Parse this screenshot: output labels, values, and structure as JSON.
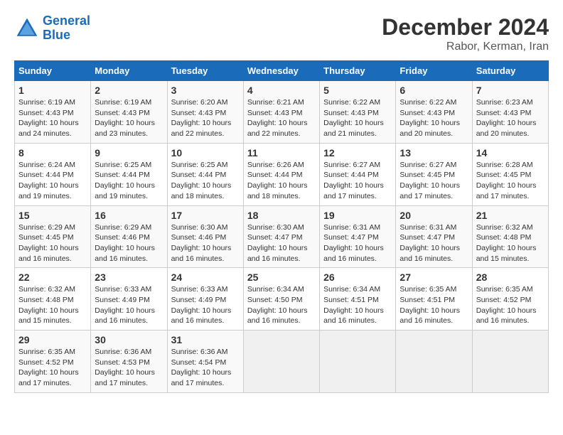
{
  "header": {
    "logo_line1": "General",
    "logo_line2": "Blue",
    "title": "December 2024",
    "subtitle": "Rabor, Kerman, Iran"
  },
  "calendar": {
    "days_of_week": [
      "Sunday",
      "Monday",
      "Tuesday",
      "Wednesday",
      "Thursday",
      "Friday",
      "Saturday"
    ],
    "weeks": [
      [
        {
          "day": "",
          "info": ""
        },
        {
          "day": "2",
          "info": "Sunrise: 6:19 AM\nSunset: 4:43 PM\nDaylight: 10 hours\nand 23 minutes."
        },
        {
          "day": "3",
          "info": "Sunrise: 6:20 AM\nSunset: 4:43 PM\nDaylight: 10 hours\nand 22 minutes."
        },
        {
          "day": "4",
          "info": "Sunrise: 6:21 AM\nSunset: 4:43 PM\nDaylight: 10 hours\nand 22 minutes."
        },
        {
          "day": "5",
          "info": "Sunrise: 6:22 AM\nSunset: 4:43 PM\nDaylight: 10 hours\nand 21 minutes."
        },
        {
          "day": "6",
          "info": "Sunrise: 6:22 AM\nSunset: 4:43 PM\nDaylight: 10 hours\nand 20 minutes."
        },
        {
          "day": "7",
          "info": "Sunrise: 6:23 AM\nSunset: 4:43 PM\nDaylight: 10 hours\nand 20 minutes."
        }
      ],
      [
        {
          "day": "1",
          "info": "Sunrise: 6:19 AM\nSunset: 4:43 PM\nDaylight: 10 hours\nand 24 minutes."
        },
        {
          "day": "9",
          "info": "Sunrise: 6:25 AM\nSunset: 4:44 PM\nDaylight: 10 hours\nand 19 minutes."
        },
        {
          "day": "10",
          "info": "Sunrise: 6:25 AM\nSunset: 4:44 PM\nDaylight: 10 hours\nand 18 minutes."
        },
        {
          "day": "11",
          "info": "Sunrise: 6:26 AM\nSunset: 4:44 PM\nDaylight: 10 hours\nand 18 minutes."
        },
        {
          "day": "12",
          "info": "Sunrise: 6:27 AM\nSunset: 4:44 PM\nDaylight: 10 hours\nand 17 minutes."
        },
        {
          "day": "13",
          "info": "Sunrise: 6:27 AM\nSunset: 4:45 PM\nDaylight: 10 hours\nand 17 minutes."
        },
        {
          "day": "14",
          "info": "Sunrise: 6:28 AM\nSunset: 4:45 PM\nDaylight: 10 hours\nand 17 minutes."
        }
      ],
      [
        {
          "day": "8",
          "info": "Sunrise: 6:24 AM\nSunset: 4:44 PM\nDaylight: 10 hours\nand 19 minutes."
        },
        {
          "day": "16",
          "info": "Sunrise: 6:29 AM\nSunset: 4:46 PM\nDaylight: 10 hours\nand 16 minutes."
        },
        {
          "day": "17",
          "info": "Sunrise: 6:30 AM\nSunset: 4:46 PM\nDaylight: 10 hours\nand 16 minutes."
        },
        {
          "day": "18",
          "info": "Sunrise: 6:30 AM\nSunset: 4:47 PM\nDaylight: 10 hours\nand 16 minutes."
        },
        {
          "day": "19",
          "info": "Sunrise: 6:31 AM\nSunset: 4:47 PM\nDaylight: 10 hours\nand 16 minutes."
        },
        {
          "day": "20",
          "info": "Sunrise: 6:31 AM\nSunset: 4:47 PM\nDaylight: 10 hours\nand 16 minutes."
        },
        {
          "day": "21",
          "info": "Sunrise: 6:32 AM\nSunset: 4:48 PM\nDaylight: 10 hours\nand 15 minutes."
        }
      ],
      [
        {
          "day": "15",
          "info": "Sunrise: 6:29 AM\nSunset: 4:45 PM\nDaylight: 10 hours\nand 16 minutes."
        },
        {
          "day": "23",
          "info": "Sunrise: 6:33 AM\nSunset: 4:49 PM\nDaylight: 10 hours\nand 16 minutes."
        },
        {
          "day": "24",
          "info": "Sunrise: 6:33 AM\nSunset: 4:49 PM\nDaylight: 10 hours\nand 16 minutes."
        },
        {
          "day": "25",
          "info": "Sunrise: 6:34 AM\nSunset: 4:50 PM\nDaylight: 10 hours\nand 16 minutes."
        },
        {
          "day": "26",
          "info": "Sunrise: 6:34 AM\nSunset: 4:51 PM\nDaylight: 10 hours\nand 16 minutes."
        },
        {
          "day": "27",
          "info": "Sunrise: 6:35 AM\nSunset: 4:51 PM\nDaylight: 10 hours\nand 16 minutes."
        },
        {
          "day": "28",
          "info": "Sunrise: 6:35 AM\nSunset: 4:52 PM\nDaylight: 10 hours\nand 16 minutes."
        }
      ],
      [
        {
          "day": "22",
          "info": "Sunrise: 6:32 AM\nSunset: 4:48 PM\nDaylight: 10 hours\nand 15 minutes."
        },
        {
          "day": "30",
          "info": "Sunrise: 6:36 AM\nSunset: 4:53 PM\nDaylight: 10 hours\nand 17 minutes."
        },
        {
          "day": "31",
          "info": "Sunrise: 6:36 AM\nSunset: 4:54 PM\nDaylight: 10 hours\nand 17 minutes."
        },
        {
          "day": "",
          "info": ""
        },
        {
          "day": "",
          "info": ""
        },
        {
          "day": "",
          "info": ""
        },
        {
          "day": "",
          "info": ""
        }
      ],
      [
        {
          "day": "29",
          "info": "Sunrise: 6:35 AM\nSunset: 4:52 PM\nDaylight: 10 hours\nand 17 minutes."
        },
        {
          "day": "",
          "info": ""
        },
        {
          "day": "",
          "info": ""
        },
        {
          "day": "",
          "info": ""
        },
        {
          "day": "",
          "info": ""
        },
        {
          "day": "",
          "info": ""
        },
        {
          "day": "",
          "info": ""
        }
      ]
    ]
  }
}
